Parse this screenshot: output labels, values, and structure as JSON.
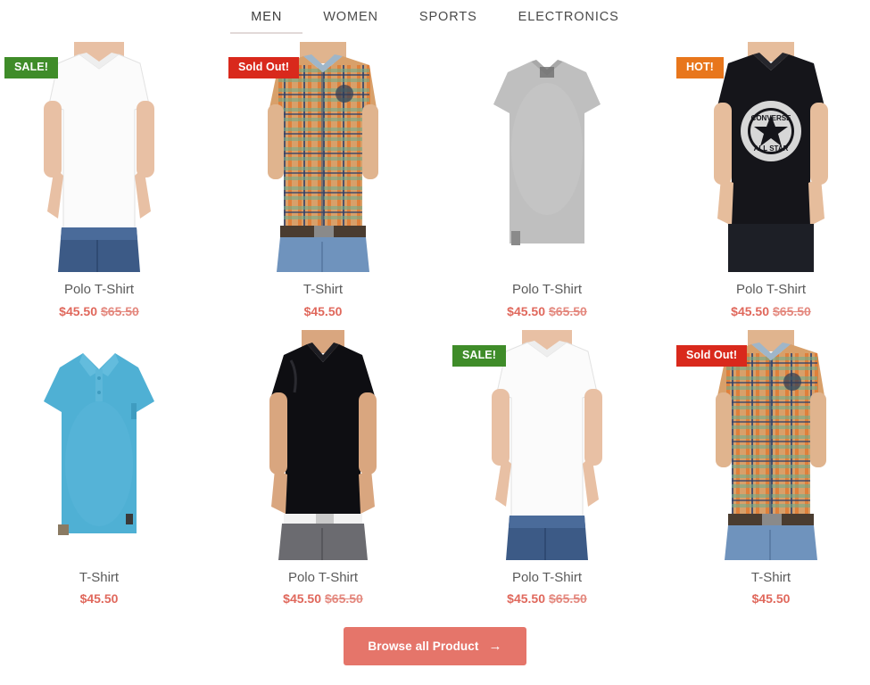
{
  "nav": {
    "items": [
      {
        "label": "MEN",
        "active": true
      },
      {
        "label": "WOMEN",
        "active": false
      },
      {
        "label": "SPORTS",
        "active": false
      },
      {
        "label": "ELECTRONICS",
        "active": false
      }
    ]
  },
  "colors": {
    "sale_badge": "#3f8c29",
    "soldout_badge": "#d9291c",
    "hot_badge": "#e8761c",
    "price": "#e0685c",
    "price_old": "#e4897f",
    "cta_button": "#e5756a",
    "active_tab_underline": "#e2d9d8"
  },
  "products": [
    {
      "badge": "SALE!",
      "badge_type": "sale",
      "image": "man-white-tshirt-blue-jeans",
      "title": "Polo T-Shirt",
      "price": "$45.50",
      "price_old": "$65.50"
    },
    {
      "badge": "Sold Out!",
      "badge_type": "soldout",
      "image": "man-orange-plaid-shirt-jeans",
      "title": "T-Shirt",
      "price": "$45.50",
      "price_old": ""
    },
    {
      "badge": "",
      "badge_type": "",
      "image": "grey-heather-tshirt-flat",
      "title": "Polo T-Shirt",
      "price": "$45.50",
      "price_old": "$65.50"
    },
    {
      "badge": "HOT!",
      "badge_type": "hot",
      "image": "man-black-converse-allstar-tshirt",
      "title": "Polo T-Shirt",
      "price": "$45.50",
      "price_old": "$65.50"
    },
    {
      "badge": "",
      "badge_type": "",
      "image": "light-blue-polo-shirt-flat",
      "title": "T-Shirt",
      "price": "$45.50",
      "price_old": ""
    },
    {
      "badge": "",
      "badge_type": "",
      "image": "man-black-tshirt-white-belt-grey-jeans",
      "title": "Polo T-Shirt",
      "price": "$45.50",
      "price_old": "$65.50"
    },
    {
      "badge": "SALE!",
      "badge_type": "sale",
      "image": "man-white-tshirt-blue-jeans",
      "title": "Polo T-Shirt",
      "price": "$45.50",
      "price_old": "$65.50"
    },
    {
      "badge": "Sold Out!",
      "badge_type": "soldout",
      "image": "man-orange-plaid-shirt-jeans",
      "title": "T-Shirt",
      "price": "$45.50",
      "price_old": ""
    }
  ],
  "cta": {
    "label": "Browse all Product",
    "arrow": "→"
  }
}
